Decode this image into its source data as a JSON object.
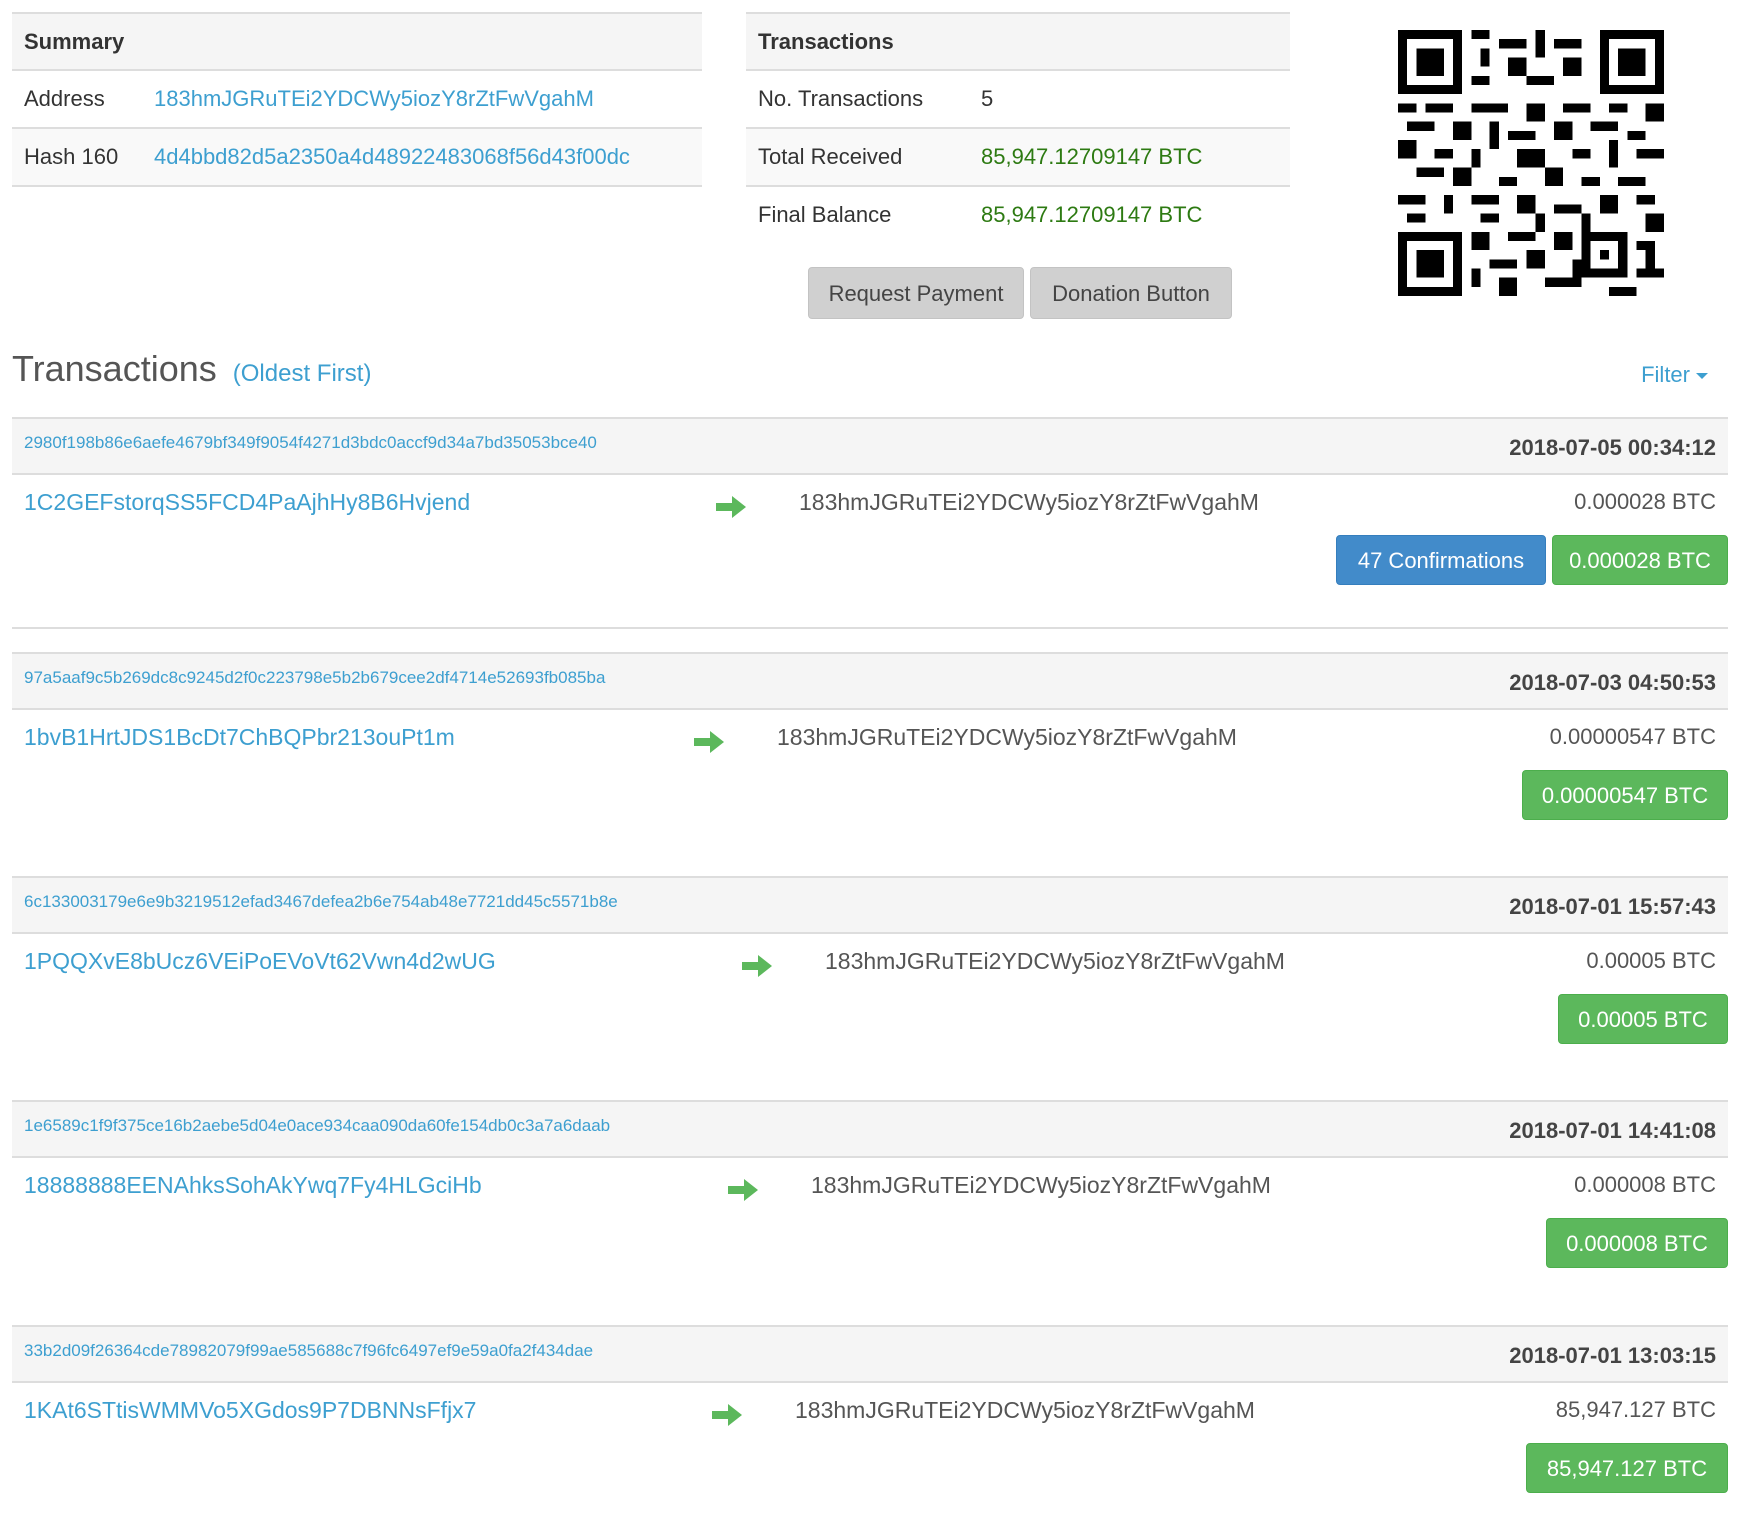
{
  "summary": {
    "heading": "Summary",
    "address_label": "Address",
    "address_value": "183hmJGRuTEi2YDCWy5iozY8rZtFwVgahM",
    "hash_label": "Hash 160",
    "hash_value": "4d4bbd82d5a2350a4d48922483068f56d43f00dc"
  },
  "transactions_table": {
    "heading": "Transactions",
    "count_label": "No. Transactions",
    "count_value": "5",
    "received_label": "Total Received",
    "received_value": "85,947.12709147 BTC",
    "balance_label": "Final Balance",
    "balance_value": "85,947.12709147 BTC"
  },
  "buttons": {
    "request_payment": "Request Payment",
    "donation_button": "Donation Button"
  },
  "list": {
    "title": "Transactions",
    "subtitle": "(Oldest First)",
    "filter": "Filter"
  },
  "txs": [
    {
      "hash": "2980f198b86e6aefe4679bf349f9054f4271d3bdc0accf9d34a7bd35053bce40",
      "date": "2018-07-05 00:34:12",
      "from": "1C2GEFstorqSS5FCD4PaAjhHy8B6Hvjend",
      "to": "183hmJGRuTEi2YDCWy5iozY8rZtFwVgahM",
      "amount": "0.000028 BTC",
      "confirmations": "47 Confirmations",
      "badge": "0.000028 BTC"
    },
    {
      "hash": "97a5aaf9c5b269dc8c9245d2f0c223798e5b2b679cee2df4714e52693fb085ba",
      "date": "2018-07-03 04:50:53",
      "from": "1bvB1HrtJDS1BcDt7ChBQPbr213ouPt1m",
      "to": "183hmJGRuTEi2YDCWy5iozY8rZtFwVgahM",
      "amount": "0.00000547 BTC",
      "badge": "0.00000547 BTC"
    },
    {
      "hash": "6c133003179e6e9b3219512efad3467defea2b6e754ab48e7721dd45c5571b8e",
      "date": "2018-07-01 15:57:43",
      "from": "1PQQXvE8bUcz6VEiPoEVoVt62Vwn4d2wUG",
      "to": "183hmJGRuTEi2YDCWy5iozY8rZtFwVgahM",
      "amount": "0.00005 BTC",
      "badge": "0.00005 BTC"
    },
    {
      "hash": "1e6589c1f9f375ce16b2aebe5d04e0ace934caa090da60fe154db0c3a7a6daab",
      "date": "2018-07-01 14:41:08",
      "from": "18888888EENAhksSohAkYwq7Fy4HLGciHb",
      "to": "183hmJGRuTEi2YDCWy5iozY8rZtFwVgahM",
      "amount": "0.000008 BTC",
      "badge": "0.000008 BTC"
    },
    {
      "hash": "33b2d09f26364cde78982079f99ae585688c7f96fc6497ef9e59a0fa2f434dae",
      "date": "2018-07-01 13:03:15",
      "from": "1KAt6STtisWMMVo5XGdos9P7DBNNsFfjx7",
      "to": "183hmJGRuTEi2YDCWy5iozY8rZtFwVgahM",
      "amount": "85,947.127 BTC",
      "badge": "85,947.127 BTC"
    }
  ],
  "icons": {
    "qr": "qr-code-icon",
    "arrow": "arrow-right-icon",
    "filter_caret": "caret-down-icon"
  },
  "colors": {
    "link": "#3d9fd0",
    "green_value": "#2d7a12",
    "badge_green": "#5cb85c",
    "badge_blue": "#428bca"
  }
}
